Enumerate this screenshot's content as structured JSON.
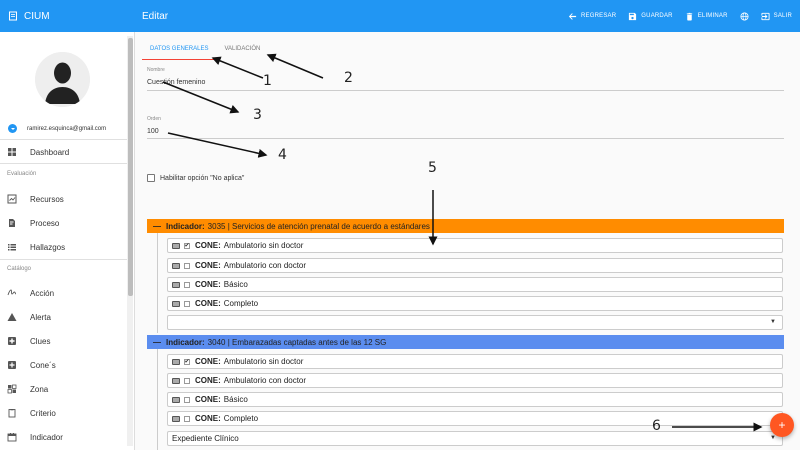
{
  "app": {
    "name": "CIUM",
    "page_title": "Editar"
  },
  "toolbar": {
    "back_label": "REGRESAR",
    "save_label": "GUARDAR",
    "delete_label": "ELIMINAR",
    "exit_label": "SALIR"
  },
  "user": {
    "email": "ramirez.esquinca@gmail.com"
  },
  "sidebar": {
    "dashboard": "Dashboard",
    "section_eval": "Evaluación",
    "eval_items": [
      "Recursos",
      "Proceso",
      "Hallazgos"
    ],
    "section_catalog": "Catálogo",
    "catalog_items": [
      "Acción",
      "Alerta",
      "Clues",
      "Cone´s",
      "Zona",
      "Criterio",
      "Indicador"
    ]
  },
  "tabs": [
    {
      "label": "DATOS GENERALES",
      "active": true
    },
    {
      "label": "VALIDACIÓN",
      "active": false
    }
  ],
  "form": {
    "nombre_label": "Nombre",
    "nombre_value": "Cuestión femenino",
    "orden_label": "Orden",
    "orden_value": "100",
    "no_aplica_label": "Habilitar opción \"No aplica\""
  },
  "indicators": [
    {
      "prefix": "Indicador:",
      "text": "3035 | Servicios de atención prenatal de acuerdo a estándares",
      "color": "#ff8c00",
      "cones": [
        {
          "label": "CONE:",
          "name": "Ambulatorio sin doctor",
          "checked": true
        },
        {
          "label": "CONE:",
          "name": "Ambulatorio con doctor",
          "checked": false
        },
        {
          "label": "CONE:",
          "name": "Básico",
          "checked": false
        },
        {
          "label": "CONE:",
          "name": "Completo",
          "checked": false
        }
      ],
      "select_value": ""
    },
    {
      "prefix": "Indicador:",
      "text": "3040 | Embarazadas captadas antes de las 12 SG",
      "color": "#5b8def",
      "cones": [
        {
          "label": "CONE:",
          "name": "Ambulatorio sin doctor",
          "checked": true
        },
        {
          "label": "CONE:",
          "name": "Ambulatorio con doctor",
          "checked": false
        },
        {
          "label": "CONE:",
          "name": "Básico",
          "checked": false
        },
        {
          "label": "CONE:",
          "name": "Completo",
          "checked": false
        }
      ],
      "select_value": "Expediente Clínico"
    }
  ],
  "fab": {
    "label": "+"
  },
  "annotations": [
    "1",
    "2",
    "3",
    "4",
    "5",
    "6"
  ],
  "colors": {
    "primary": "#2196f3",
    "accent": "#f44336",
    "fab": "#ff5722"
  }
}
